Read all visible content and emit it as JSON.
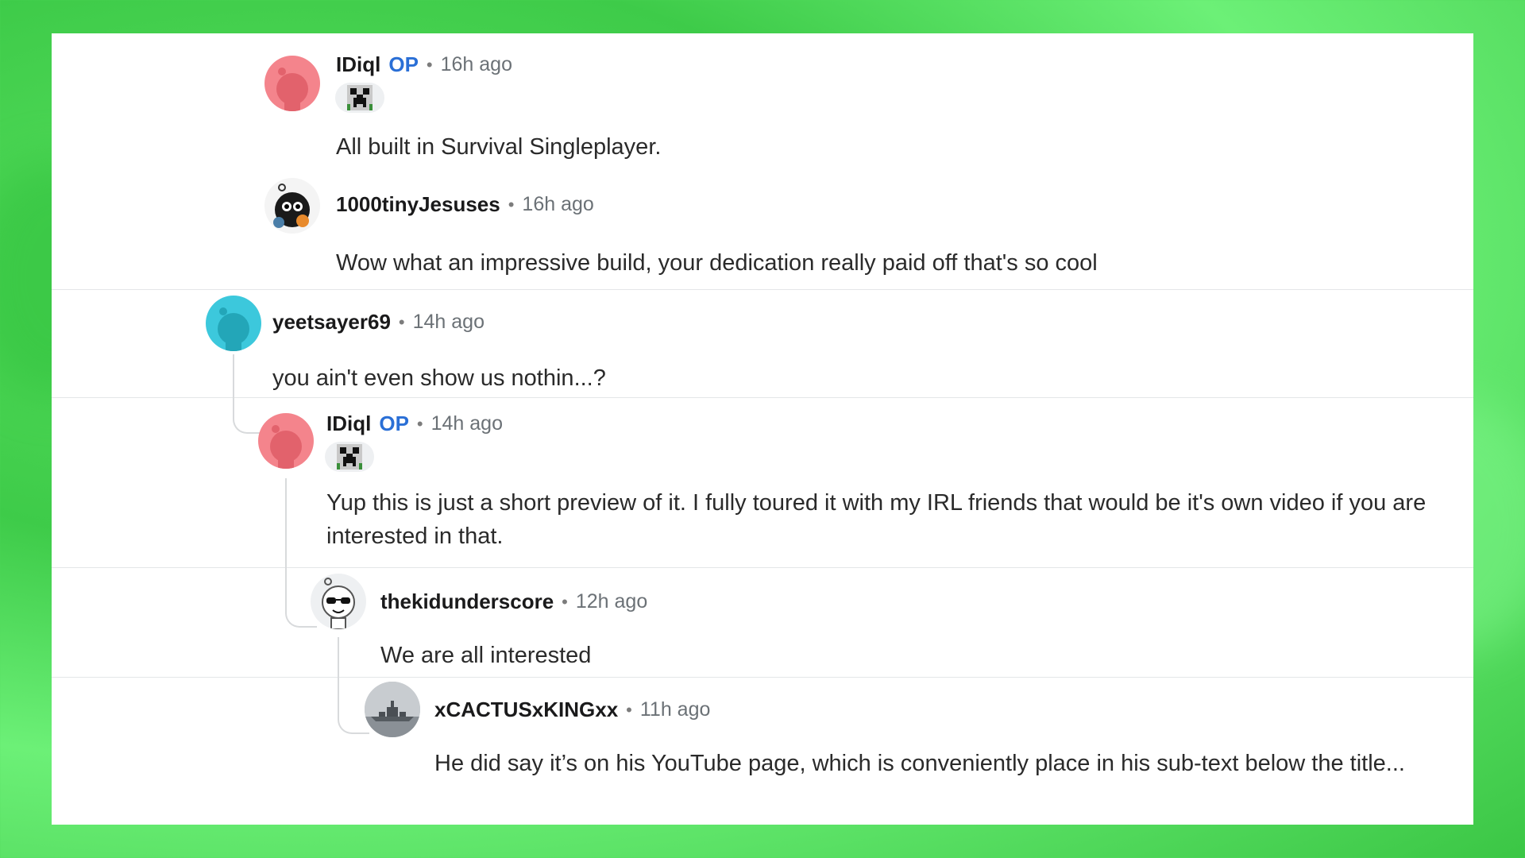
{
  "comments": [
    {
      "author": "IDiql",
      "op": "OP",
      "time": "16h ago",
      "text": "All built in Survival Singleplayer.",
      "avatar": "pink-snoo-avatar",
      "flair": "pixel-creeper-flair"
    },
    {
      "author": "1000tinyJesuses",
      "time": "16h ago",
      "text": "Wow what an impressive build, your dedication really paid off that's so cool",
      "avatar": "custom-snoo-avatar"
    },
    {
      "author": "yeetsayer69",
      "time": "14h ago",
      "text": "you ain't even show us nothin...?",
      "avatar": "cyan-snoo-avatar"
    },
    {
      "author": "IDiql",
      "op": "OP",
      "time": "14h ago",
      "text": "Yup this is just a short preview of it. I fully toured it with my IRL friends that would be it's own video if you are interested in that.",
      "avatar": "pink-snoo-avatar",
      "flair": "pixel-creeper-flair"
    },
    {
      "author": "thekidunderscore",
      "time": "12h ago",
      "text": "We are all interested",
      "avatar": "sunglasses-snoo-avatar"
    },
    {
      "author": "xCACTUSxKINGxx",
      "time": "11h ago",
      "text": "He did say it’s on his YouTube page, which is conveniently place in his sub-text below the title...",
      "avatar": "battleship-photo-avatar"
    }
  ],
  "separator": "•",
  "colors": {
    "op": "#2a6fd6",
    "background": "#4cd657",
    "pink_avatar": "#f4848c",
    "cyan_avatar": "#3cc8dc"
  }
}
